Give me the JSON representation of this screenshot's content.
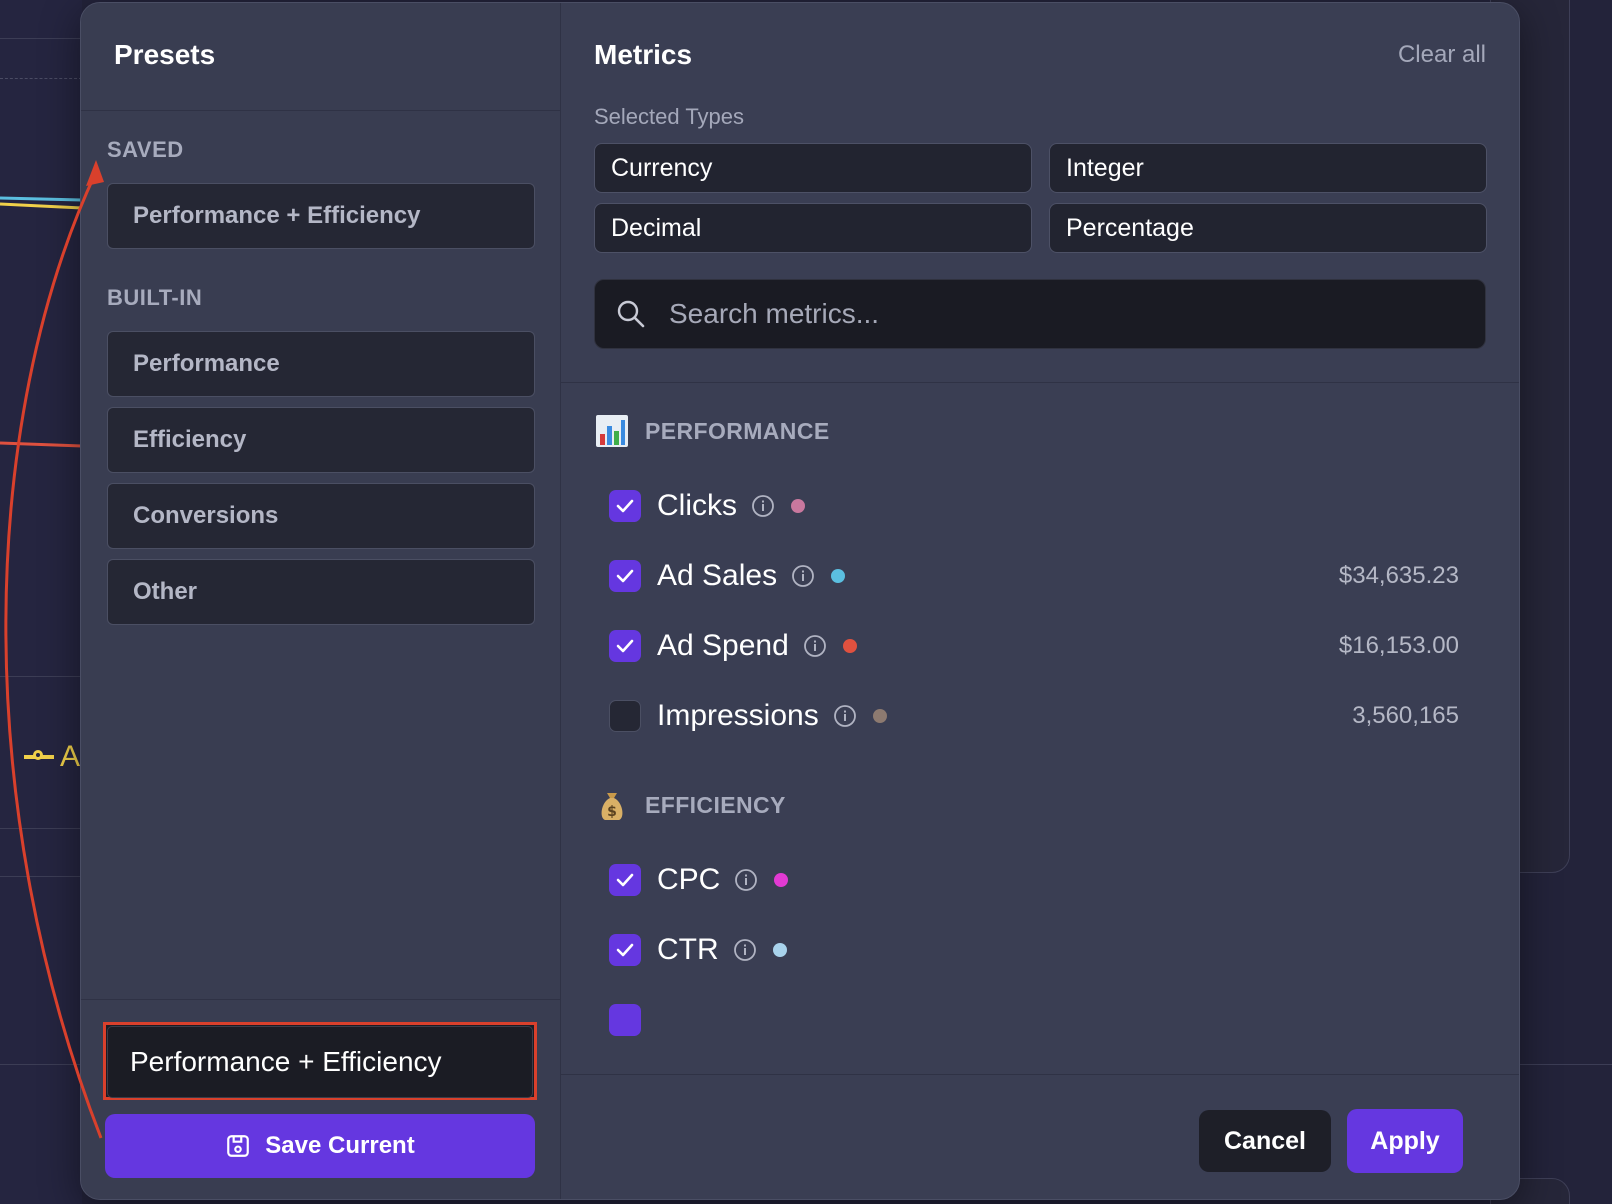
{
  "presets": {
    "title": "Presets",
    "saved_label": "SAVED",
    "saved_items": [
      {
        "label": "Performance + Efficiency"
      }
    ],
    "builtin_label": "BUILT-IN",
    "builtin_items": [
      {
        "label": "Performance"
      },
      {
        "label": "Efficiency"
      },
      {
        "label": "Conversions"
      },
      {
        "label": "Other"
      }
    ],
    "name_input_value": "Performance + Efficiency",
    "save_button_label": "Save Current"
  },
  "metrics": {
    "title": "Metrics",
    "clear_all_label": "Clear all",
    "selected_types_label": "Selected Types",
    "types": [
      "Currency",
      "Integer",
      "Decimal",
      "Percentage"
    ],
    "search_placeholder": "Search metrics...",
    "groups": [
      {
        "name": "PERFORMANCE",
        "icon": "bar-chart-emoji-icon",
        "items": [
          {
            "name": "Clicks",
            "checked": true,
            "color": "#c9789e",
            "value": ""
          },
          {
            "name": "Ad Sales",
            "checked": true,
            "color": "#5bbfe0",
            "value": "$34,635.23"
          },
          {
            "name": "Ad Spend",
            "checked": true,
            "color": "#e0513f",
            "value": "$16,153.00"
          },
          {
            "name": "Impressions",
            "checked": false,
            "color": "#8d7a70",
            "value": "3,560,165"
          }
        ]
      },
      {
        "name": "EFFICIENCY",
        "icon": "money-bag-emoji-icon",
        "items": [
          {
            "name": "CPC",
            "checked": true,
            "color": "#e23ad3",
            "value": ""
          },
          {
            "name": "CTR",
            "checked": true,
            "color": "#a9d3ec",
            "value": ""
          }
        ]
      }
    ],
    "cancel_label": "Cancel",
    "apply_label": "Apply"
  },
  "background": {
    "legend_fragment": "A"
  },
  "colors": {
    "accent": "#6537e0",
    "annotation": "#d9402c",
    "modal_bg": "#3a3e53"
  }
}
